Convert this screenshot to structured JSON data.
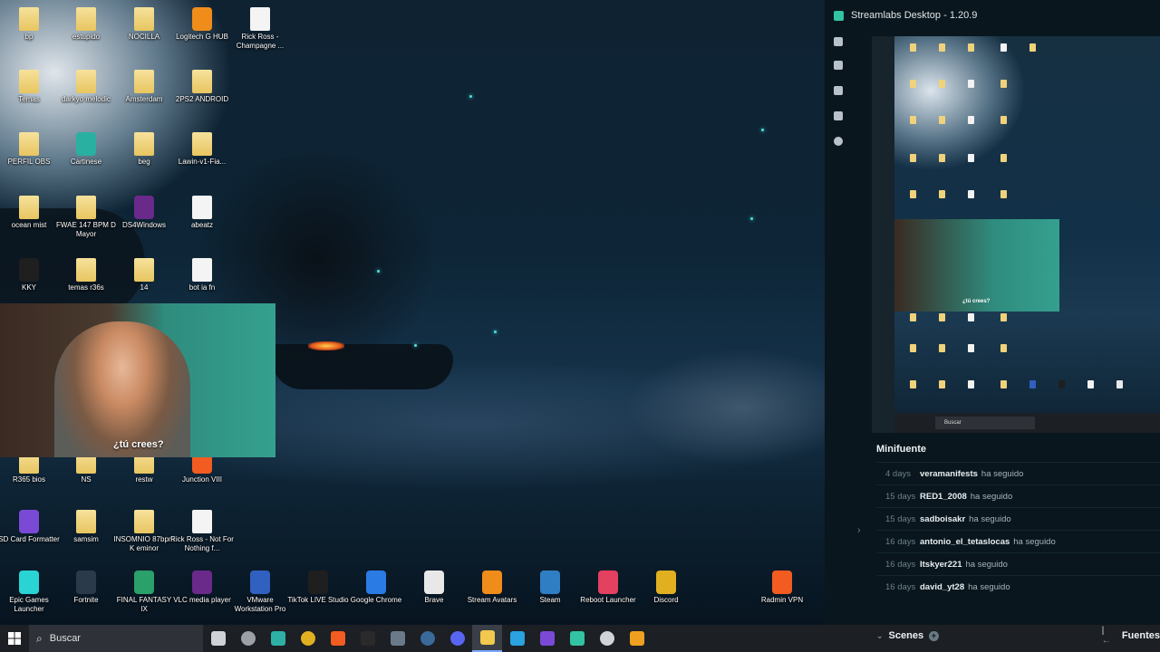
{
  "desktop": {
    "icons": [
      {
        "label": "bp",
        "kind": "folder"
      },
      {
        "label": "estupido",
        "kind": "folder"
      },
      {
        "label": "NOCILLA",
        "kind": "folder"
      },
      {
        "label": "Logitech G HUB",
        "kind": "app"
      },
      {
        "label": "Rick Ross - Champagne ...",
        "kind": "file"
      },
      {
        "label": "Temas",
        "kind": "folder"
      },
      {
        "label": "darkyo melodic",
        "kind": "folder"
      },
      {
        "label": "Amsterdam",
        "kind": "folder"
      },
      {
        "label": "2PS2 ANDROID",
        "kind": "folder"
      },
      {
        "label": "PERFIL OBS",
        "kind": "folder"
      },
      {
        "label": "Cartinese",
        "kind": "app"
      },
      {
        "label": "beg",
        "kind": "folder"
      },
      {
        "label": "Lawin-v1-Fia...",
        "kind": "folder"
      },
      {
        "label": "ocean mist",
        "kind": "folder"
      },
      {
        "label": "FWAE 147 BPM D Mayor",
        "kind": "folder"
      },
      {
        "label": "DS4Windows",
        "kind": "app"
      },
      {
        "label": "abeatz",
        "kind": "file"
      },
      {
        "label": "KKY",
        "kind": "app"
      },
      {
        "label": "temas r36s",
        "kind": "folder"
      },
      {
        "label": "14",
        "kind": "folder"
      },
      {
        "label": "bot ia fn",
        "kind": "file"
      },
      {
        "label": "R365 bios",
        "kind": "folder"
      },
      {
        "label": "NS",
        "kind": "folder"
      },
      {
        "label": "restw",
        "kind": "folder"
      },
      {
        "label": "Junction VIII",
        "kind": "app"
      },
      {
        "label": "SD Card Formatter",
        "kind": "app"
      },
      {
        "label": "samsim",
        "kind": "folder"
      },
      {
        "label": "INSOMNIO 87bpm K eminor",
        "kind": "folder"
      },
      {
        "label": "Rick Ross - Not For Nothing f...",
        "kind": "file"
      },
      {
        "label": "Epic Games Launcher",
        "kind": "app"
      },
      {
        "label": "Fortnite",
        "kind": "app"
      },
      {
        "label": "FINAL FANTASY IX",
        "kind": "app"
      },
      {
        "label": "VLC media player",
        "kind": "app"
      },
      {
        "label": "VMware Workstation Pro",
        "kind": "app"
      },
      {
        "label": "TikTok LIVE Studio",
        "kind": "app"
      },
      {
        "label": "Google Chrome",
        "kind": "app"
      },
      {
        "label": "Brave",
        "kind": "app"
      },
      {
        "label": "Stream Avatars",
        "kind": "app"
      },
      {
        "label": "Steam",
        "kind": "app"
      },
      {
        "label": "Reboot Launcher",
        "kind": "app"
      },
      {
        "label": "Discord",
        "kind": "app"
      },
      {
        "label": "Radmin VPN",
        "kind": "app"
      }
    ],
    "webcam_caption": "¿tú crees?"
  },
  "taskbar": {
    "search_placeholder": "Buscar",
    "pinned": [
      {
        "name": "task-view",
        "color": "#cfd3d8"
      },
      {
        "name": "copilot",
        "color": "#9aa0a6"
      },
      {
        "name": "edge",
        "color": "#2fb0a6"
      },
      {
        "name": "chrome",
        "color": "#e0b020"
      },
      {
        "name": "brave",
        "color": "#f25c20"
      },
      {
        "name": "epic-games",
        "color": "#2a2a2a"
      },
      {
        "name": "media-app",
        "color": "#6a7a8a"
      },
      {
        "name": "steam",
        "color": "#3a6a9a"
      },
      {
        "name": "discord",
        "color": "#5865f2"
      },
      {
        "name": "file-explorer",
        "color": "#f2c94c"
      },
      {
        "name": "telegram",
        "color": "#2aa3e0"
      },
      {
        "name": "stream-avatars",
        "color": "#7a4ad6"
      },
      {
        "name": "streamlabs",
        "color": "#31c3a2"
      },
      {
        "name": "ghost-app",
        "color": "#d0d4d8"
      },
      {
        "name": "vmware",
        "color": "#f0a020"
      }
    ]
  },
  "streamlabs": {
    "title": "Streamlabs Desktop - 1.20.9",
    "preview_caption": "¿tú crees?",
    "preview_search": "Buscar",
    "minifuente_header": "Minifuente",
    "events": [
      {
        "time": "4 days",
        "user": "veramanifests",
        "action": "ha seguido"
      },
      {
        "time": "15 days",
        "user": "RED1_2008",
        "action": "ha seguido"
      },
      {
        "time": "15 days",
        "user": "sadboisakr",
        "action": "ha seguido"
      },
      {
        "time": "16 days",
        "user": "antonio_el_tetaslocas",
        "action": "ha seguido"
      },
      {
        "time": "16 days",
        "user": "Itskyer221",
        "action": "ha seguido"
      },
      {
        "time": "16 days",
        "user": "david_yt28",
        "action": "ha seguido"
      }
    ],
    "scenes_label": "Scenes",
    "sources_label": "Fuentes"
  }
}
